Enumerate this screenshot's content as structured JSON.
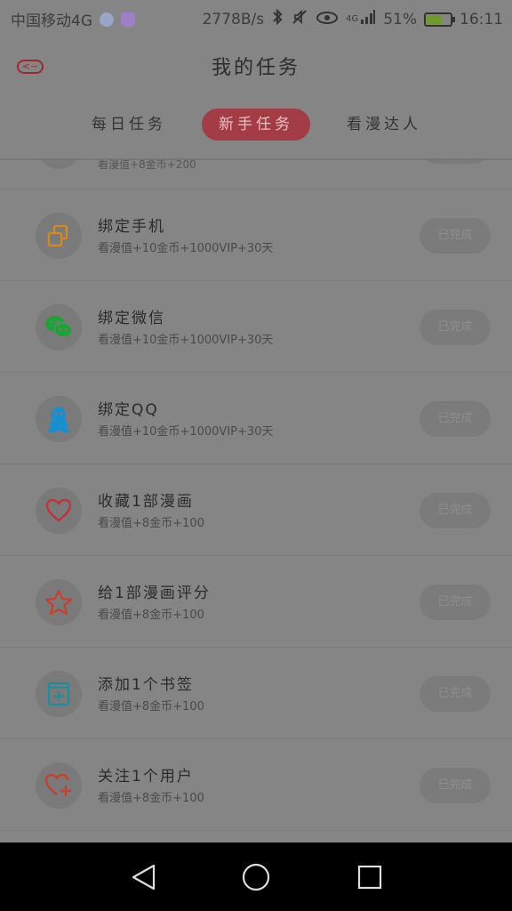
{
  "status_bar": {
    "carrier": "中国移动4G",
    "speed": "2778B/s",
    "network": "4G",
    "battery": "51%",
    "time": "16:11"
  },
  "header": {
    "back_label": "<~",
    "title": "我的任务"
  },
  "tabs": [
    {
      "label": "每日任务",
      "active": false
    },
    {
      "label": "新手任务",
      "active": true
    },
    {
      "label": "看漫达人",
      "active": false
    }
  ],
  "partial_row": {
    "reward": "看漫值+8金币+200"
  },
  "tasks": [
    {
      "name": "绑定手机",
      "reward": "看漫值+10金币+1000VIP+30天",
      "icon": "phone-bind-icon",
      "icon_color": "#d68a1d",
      "button": "已完成"
    },
    {
      "name": "绑定微信",
      "reward": "看漫值+10金币+1000VIP+30天",
      "icon": "wechat-icon",
      "icon_color": "#1fa238",
      "button": "已完成"
    },
    {
      "name": "绑定QQ",
      "reward": "看漫值+10金币+1000VIP+30天",
      "icon": "qq-icon",
      "icon_color": "#1a8fcf",
      "button": "已完成"
    },
    {
      "name": "收藏1部漫画",
      "reward": "看漫值+8金币+100",
      "icon": "heart-icon",
      "icon_color": "#c2333b",
      "button": "已完成"
    },
    {
      "name": "给1部漫画评分",
      "reward": "看漫值+8金币+100",
      "icon": "star-icon",
      "icon_color": "#c5402f",
      "button": "已完成"
    },
    {
      "name": "添加1个书签",
      "reward": "看漫值+8金币+100",
      "icon": "bookmark-add-icon",
      "icon_color": "#1b8f9a",
      "button": "已完成"
    },
    {
      "name": "关注1个用户",
      "reward": "看漫值+8金币+100",
      "icon": "follow-user-icon",
      "icon_color": "#c5402f",
      "button": "已完成"
    }
  ],
  "colors": {
    "accent": "#a33c45",
    "overlay_bg": "#858585"
  }
}
